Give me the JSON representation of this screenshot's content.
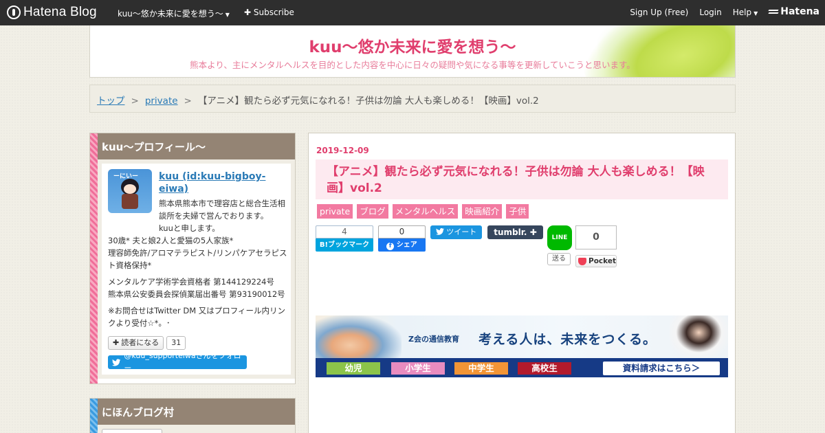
{
  "globalbar": {
    "logo": "Hatena Blog",
    "blog_name": "kuu～悠か未来に愛を想う～",
    "subscribe": "Subscribe",
    "signup": "Sign Up (Free)",
    "login": "Login",
    "help": "Help",
    "hatena": "Hatena"
  },
  "header": {
    "title": "kuu～悠か未来に愛を想う～",
    "description": "熊本より、主にメンタルヘルスを目的とした内容を中心に日々の疑問や気になる事等を更新していこうと思います。"
  },
  "breadcrumb": {
    "top": "トップ",
    "sep": ">",
    "category": "private",
    "current": "【アニメ】観たら必ず元気になれる！子供は勿論 大人も楽しめる！【映画】vol.2"
  },
  "sidebar": {
    "profile": {
      "module_title": "kuu～プロフィール～",
      "avatar_text": "ーにいー",
      "name": "kuu (id:kuu-bigboy-eiwa)",
      "intro": "熊本県熊本市で理容店と総合生活相談所を夫婦で営んでおります。",
      "intro2": "kuuと申します。",
      "family": "30歳* 夫と娘2人と愛猫の5人家族*",
      "licenses": "理容師免許/アロマテラピスト/リンパケアセラピスト資格保持*",
      "cert1": "メンタルケア学術学会資格者 第144129224号",
      "cert2": "熊本県公安委員会探偵業届出番号 第93190012号",
      "contact": "※お問合せはTwitter DM 又はプロフィール内リンクより受付☆*。･",
      "reader_button": "読者になる",
      "reader_count": "31",
      "follow_button": "@kuu_supporteiwaさんをフォロー"
    },
    "village": {
      "module_title": "にほんブログ村"
    }
  },
  "article": {
    "date": "2019-12-09",
    "title": "【アニメ】観たら必ず元気になれる！子供は勿論 大人も楽しめる！【映画】vol.2",
    "categories": [
      "private",
      "ブログ",
      "メンタルヘルス",
      "映画紹介",
      "子供"
    ],
    "share": {
      "hatebu_count": "4",
      "hatebu_label": "B!ブックマーク",
      "fb_count": "0",
      "fb_label": "シェア",
      "tweet_label": "ツイート",
      "tumblr_label": "tumblr.",
      "line_label": "LINE",
      "line_send": "送る",
      "pocket_count": "0",
      "pocket_label": "Pocket"
    }
  },
  "ad": {
    "brand": "Z会の通信教育",
    "slogan": "考える人は、未来をつくる。",
    "tabs": [
      {
        "label": "幼児",
        "color": "#8cc44a"
      },
      {
        "label": "小学生",
        "color": "#e98cbf"
      },
      {
        "label": "中学生",
        "color": "#f29536"
      },
      {
        "label": "高校生",
        "color": "#b21a2c"
      }
    ],
    "cta": "資料請求はこちら＞"
  },
  "colors": {
    "accent": "#e03e6d",
    "category_tag": "#f27aa1",
    "module_title": "#948474",
    "link": "#2a7ab6"
  }
}
